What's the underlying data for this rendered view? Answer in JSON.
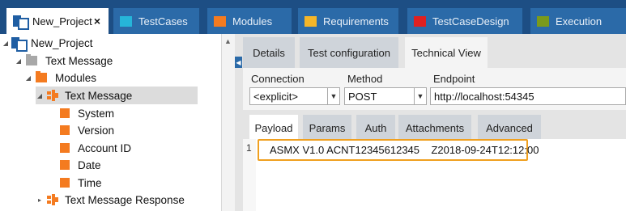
{
  "top_tabs": [
    {
      "label": "New_Project",
      "close": "×"
    },
    {
      "label": "TestCases",
      "color": "#26b5d9"
    },
    {
      "label": "Modules",
      "color": "#f47b20"
    },
    {
      "label": "Requirements",
      "color": "#f5b629"
    },
    {
      "label": "TestCaseDesign",
      "color": "#e02020"
    },
    {
      "label": "Execution",
      "color": "#7a9a1c"
    }
  ],
  "tree": {
    "root": "New_Project",
    "text_message_folder": "Text Message",
    "modules": "Modules",
    "module": "Text Message",
    "attributes": [
      "System",
      "Version",
      "Account ID",
      "Date",
      "Time"
    ],
    "response_module": "Text Message Response"
  },
  "detail_tabs": [
    "Details",
    "Test configuration",
    "Technical View"
  ],
  "form": {
    "connection_label": "Connection",
    "connection_value": "<explicit>",
    "method_label": "Method",
    "method_value": "POST",
    "endpoint_label": "Endpoint",
    "endpoint_value": "http://localhost:54345"
  },
  "payload_tabs": [
    "Payload",
    "Params",
    "Auth",
    "Attachments",
    "Advanced"
  ],
  "editor": {
    "line_number": "1",
    "payload_text": "ASMX V1.0 ACNT12345612345    Z2018-09-24T12:12:00"
  },
  "colors": {
    "accent_blue": "#1d4e84",
    "tab_blue": "#2b6aa8",
    "module_orange": "#f47b20",
    "highlight_border": "#f0a020"
  }
}
